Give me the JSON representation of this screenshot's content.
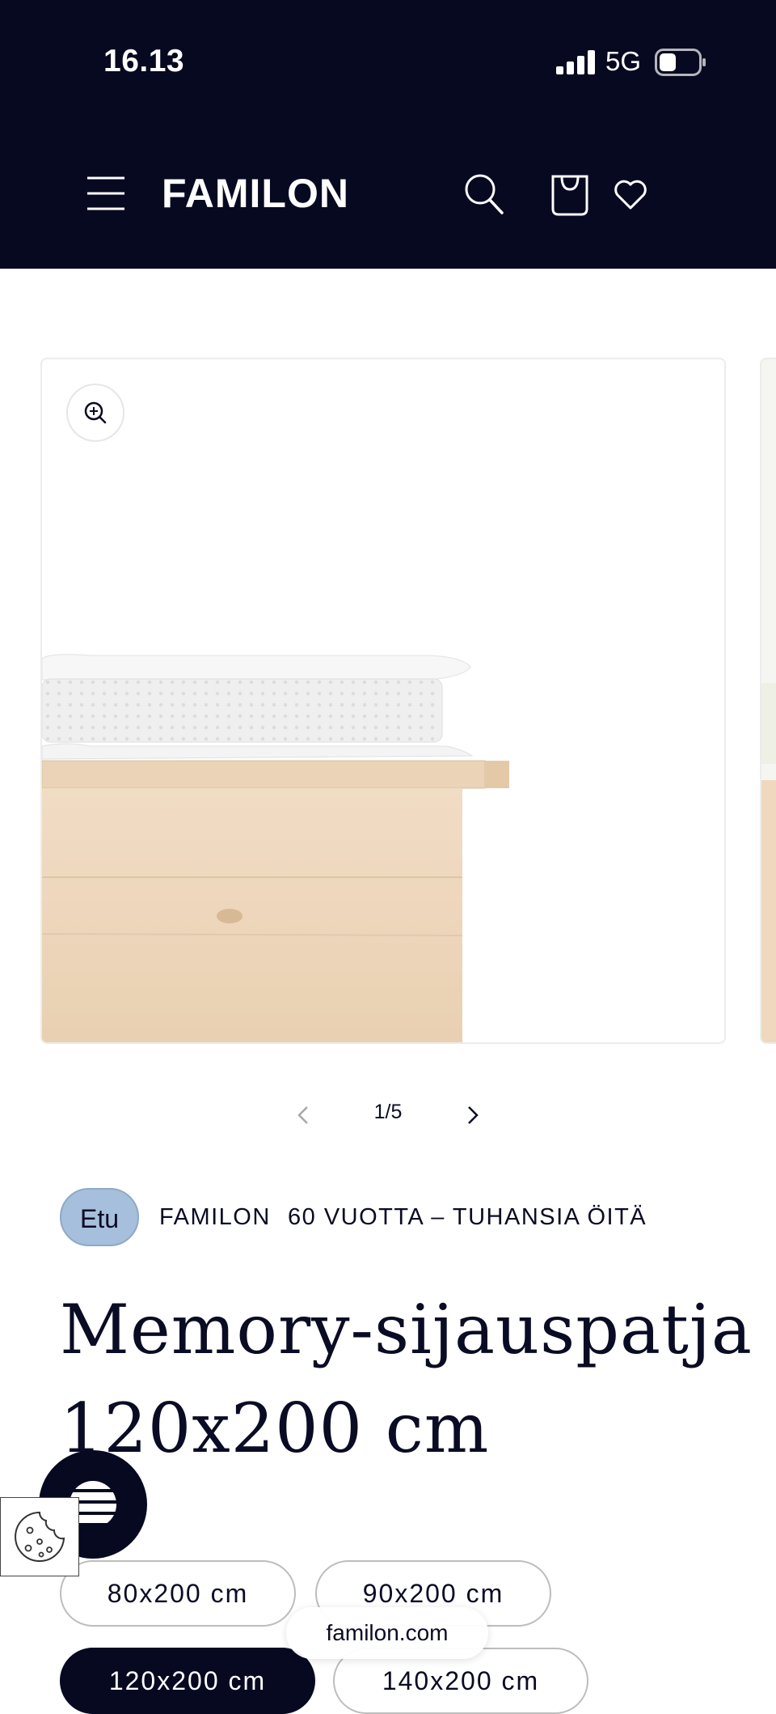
{
  "status_bar": {
    "time": "16.13",
    "network": "5G"
  },
  "header": {
    "logo": "FAMILON"
  },
  "gallery": {
    "current": "1",
    "total": "5",
    "counter": "1/5"
  },
  "product": {
    "badge": "Etu",
    "vendor": "FAMILON",
    "tagline": "60 VUOTTA – TUHANSIA ÖITÄ",
    "title_line1": "Memory-sijauspatja",
    "title_line2": "120x200 cm"
  },
  "sizes": {
    "options": [
      "80x200 cm",
      "90x200 cm",
      "120x200 cm",
      "140x200 cm"
    ],
    "selected": "120x200 cm"
  },
  "browser": {
    "url": "familon.com"
  },
  "colors": {
    "header_bg": "#070921",
    "badge_bg": "#a6bfdc",
    "text": "#0a0b24"
  },
  "icons": [
    "menu-icon",
    "search-icon",
    "cart-icon",
    "heart-icon",
    "zoom-in-icon",
    "chevron-left-icon",
    "chevron-right-icon",
    "cookie-icon"
  ]
}
